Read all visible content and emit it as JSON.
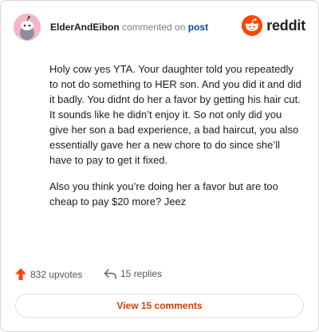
{
  "comment": {
    "username": "ElderAndEibon",
    "action_text": "commented on",
    "post_link": "post",
    "paragraphs": [
      "Holy cow yes YTA. Your daughter told you repeatedly to not do something to HER son. And you did it and did it badly. You didnt do her a favor by getting his hair cut. It sounds like he didn’t enjoy it. So not only did you give her son a bad experience, a bad haircut, you also essentially gave her a new chore to do since she’ll have to pay to get it fixed.",
      "Also you think you’re doing her a favor but are too cheap to pay $20 more? Jeez"
    ]
  },
  "brand": {
    "name": "reddit",
    "accent": "#ff4500"
  },
  "footer": {
    "upvotes_label": "832 upvotes",
    "replies_label": "15 replies",
    "upvote_color": "#ff4500"
  },
  "view_button": {
    "label": "View 15 comments",
    "color": "#d93a00"
  },
  "icons": {
    "upvote": "upvote-arrow-icon",
    "reply": "reply-arrow-icon",
    "logo": "reddit-snoo-icon",
    "avatar": "snoo-avatar-icon"
  }
}
